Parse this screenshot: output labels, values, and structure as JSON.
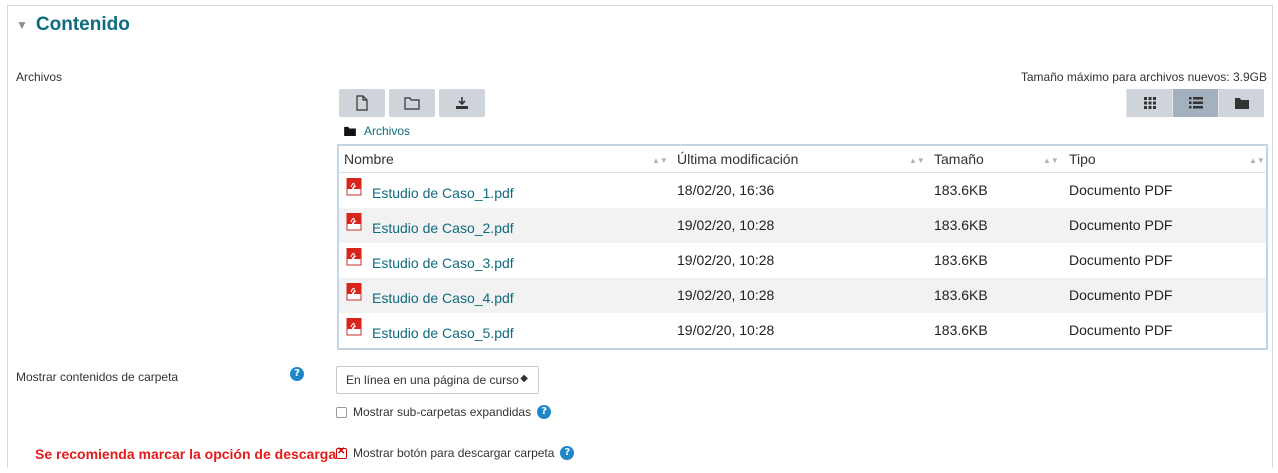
{
  "section": {
    "title": "Contenido"
  },
  "files_label": "Archivos",
  "max_size": "Tamaño máximo para archivos nuevos: 3.9GB",
  "path": {
    "label": "Archivos"
  },
  "table": {
    "headers": [
      "Nombre",
      "Última modificación",
      "Tamaño",
      "Tipo"
    ],
    "rows": [
      {
        "name": "Estudio de Caso_1.pdf",
        "modified": "18/02/20, 16:36",
        "size": "183.6KB",
        "type": "Documento PDF"
      },
      {
        "name": "Estudio de Caso_2.pdf",
        "modified": "19/02/20, 10:28",
        "size": "183.6KB",
        "type": "Documento PDF"
      },
      {
        "name": "Estudio de Caso_3.pdf",
        "modified": "19/02/20, 10:28",
        "size": "183.6KB",
        "type": "Documento PDF"
      },
      {
        "name": "Estudio de Caso_4.pdf",
        "modified": "19/02/20, 10:28",
        "size": "183.6KB",
        "type": "Documento PDF"
      },
      {
        "name": "Estudio de Caso_5.pdf",
        "modified": "19/02/20, 10:28",
        "size": "183.6KB",
        "type": "Documento PDF"
      }
    ]
  },
  "display": {
    "label": "Mostrar contenidos de carpeta",
    "selected": "En línea en una página de curso",
    "help": "?"
  },
  "subfolders": {
    "label": "Mostrar sub-carpetas expandidas",
    "checked": false
  },
  "download": {
    "label": "Mostrar botón para descargar carpeta",
    "checked": true
  },
  "recommendation": "Se recomienda marcar la opción de descarga",
  "colors": {
    "accent": "#0f6b7e",
    "warning": "#e31b1b",
    "help": "#1f86c8"
  }
}
